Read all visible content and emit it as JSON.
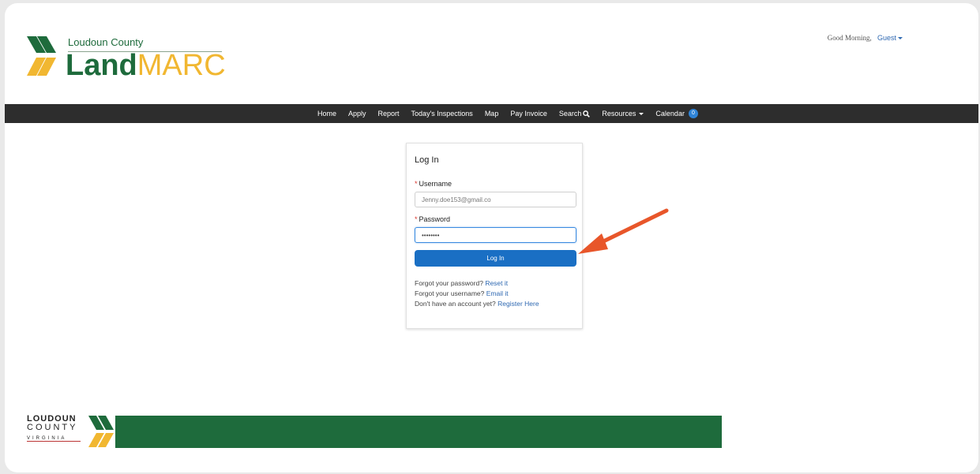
{
  "header": {
    "county": "Loudoun County",
    "brand_land": "Land",
    "brand_marc": "MARC",
    "greeting": "Good Morning,",
    "user": "Guest"
  },
  "nav": {
    "home": "Home",
    "apply": "Apply",
    "report": "Report",
    "inspections": "Today's Inspections",
    "map": "Map",
    "pay_invoice": "Pay Invoice",
    "search": "Search",
    "resources": "Resources",
    "calendar": "Calendar",
    "calendar_count": "0"
  },
  "login": {
    "title": "Log In",
    "username_label": "Username",
    "username_value": "Jenny.doe153@gmail.co",
    "password_label": "Password",
    "password_value": "••••••••",
    "button": "Log In",
    "forgot_password": "Forgot your password?",
    "reset_link": "Reset it",
    "forgot_username": "Forgot your username?",
    "email_link": "Email it",
    "no_account": "Don't have an account yet?",
    "register_link": "Register Here"
  },
  "footer": {
    "line1": "LOUDOUN",
    "line2": "COUNTY",
    "line3": "VIRGINIA"
  },
  "colors": {
    "brand_green": "#1e6b3c",
    "brand_gold": "#f1b731",
    "button_blue": "#1a6fc4",
    "nav_bg": "#2d2d2d",
    "arrow": "#e8562a"
  }
}
